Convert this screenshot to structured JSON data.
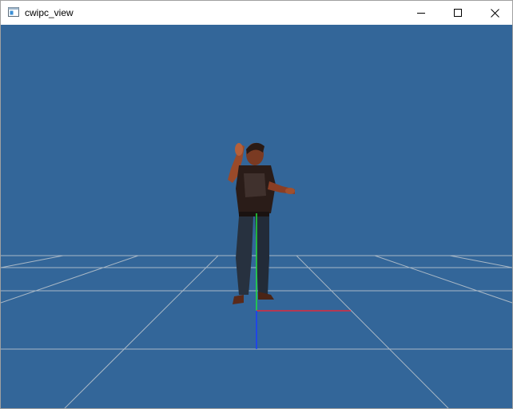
{
  "window": {
    "title": "cwipc_view",
    "controls": {
      "minimize_icon": "minimize-icon",
      "maximize_icon": "maximize-icon",
      "close_icon": "close-icon"
    }
  },
  "viewport": {
    "background_color": "#336699",
    "grid_color": "#a9b8c6",
    "axes": {
      "x_color": "#e0283c",
      "y_color": "#22e03a",
      "z_color": "#1a3cff"
    },
    "content": "point-cloud-person"
  }
}
